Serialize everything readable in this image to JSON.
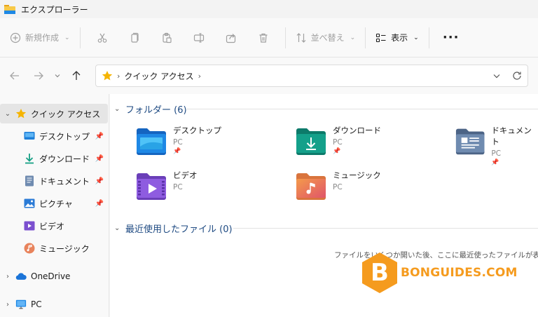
{
  "window": {
    "title": "エクスプローラー"
  },
  "toolbar": {
    "new_label": "新規作成",
    "sort_label": "並べ替え",
    "view_label": "表示",
    "more_label": "···"
  },
  "address": {
    "crumb": "クイック アクセス"
  },
  "sidebar": {
    "items": [
      {
        "label": "クイック アクセス"
      },
      {
        "label": "デスクトップ"
      },
      {
        "label": "ダウンロード"
      },
      {
        "label": "ドキュメント"
      },
      {
        "label": "ピクチャ"
      },
      {
        "label": "ビデオ"
      },
      {
        "label": "ミュージック"
      },
      {
        "label": "OneDrive"
      },
      {
        "label": "PC"
      }
    ]
  },
  "main": {
    "folders_header": "フォルダー (6)",
    "recent_header": "最近使用したファイル (0)",
    "folders": [
      {
        "name": "デスクトップ",
        "location": "PC"
      },
      {
        "name": "ダウンロード",
        "location": "PC"
      },
      {
        "name": "ドキュメント",
        "location": "PC"
      },
      {
        "name": "ビデオ",
        "location": "PC"
      },
      {
        "name": "ミュージック",
        "location": "PC"
      }
    ],
    "empty_message": "ファイルをいくつか開いた後、ここに最近使ったファイルが表示され"
  },
  "watermark": {
    "text": "BONGUIDES.COM",
    "badge": "B"
  },
  "colors": {
    "accent": "#1e4a82",
    "star": "#f5b400",
    "watermark": "#f59b1e"
  }
}
